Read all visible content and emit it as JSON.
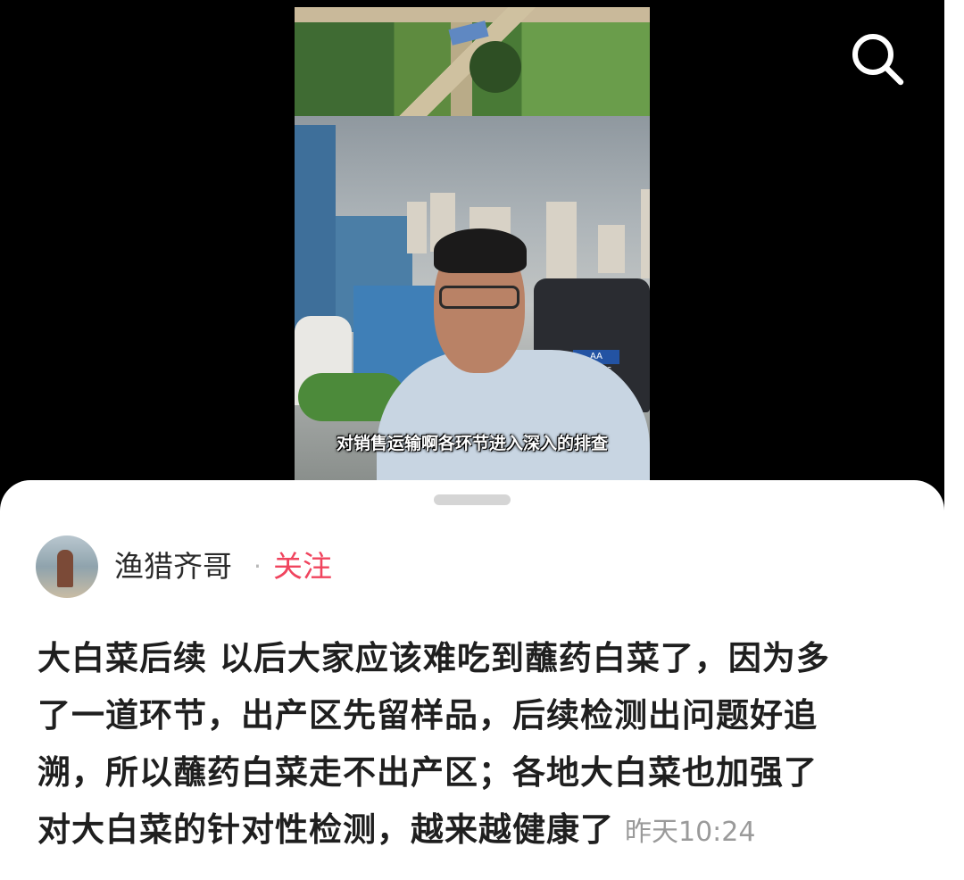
{
  "video": {
    "subtitle": "对销售运输啊各环节进入深入的排查",
    "plate_text": "AA W78T6"
  },
  "search": {
    "icon": "search-icon"
  },
  "author": {
    "name": "渔猎齐哥",
    "separator": "·",
    "follow_label": "关注"
  },
  "post": {
    "lines": [
      "大白菜后续 以后大家应该难吃到蘸药白菜了，因为多",
      "了一道环节，出产区先留样品，后续检测出问题好追",
      "溯，所以蘸药白菜走不出产区；各地大白菜也加强了",
      "对大白菜的针对性检测，越来越健康了"
    ],
    "timestamp": "昨天10:24"
  },
  "colors": {
    "follow": "#f0445e",
    "text": "#1f1f1f",
    "muted": "#9a9a9a",
    "video_background": "#000000"
  }
}
